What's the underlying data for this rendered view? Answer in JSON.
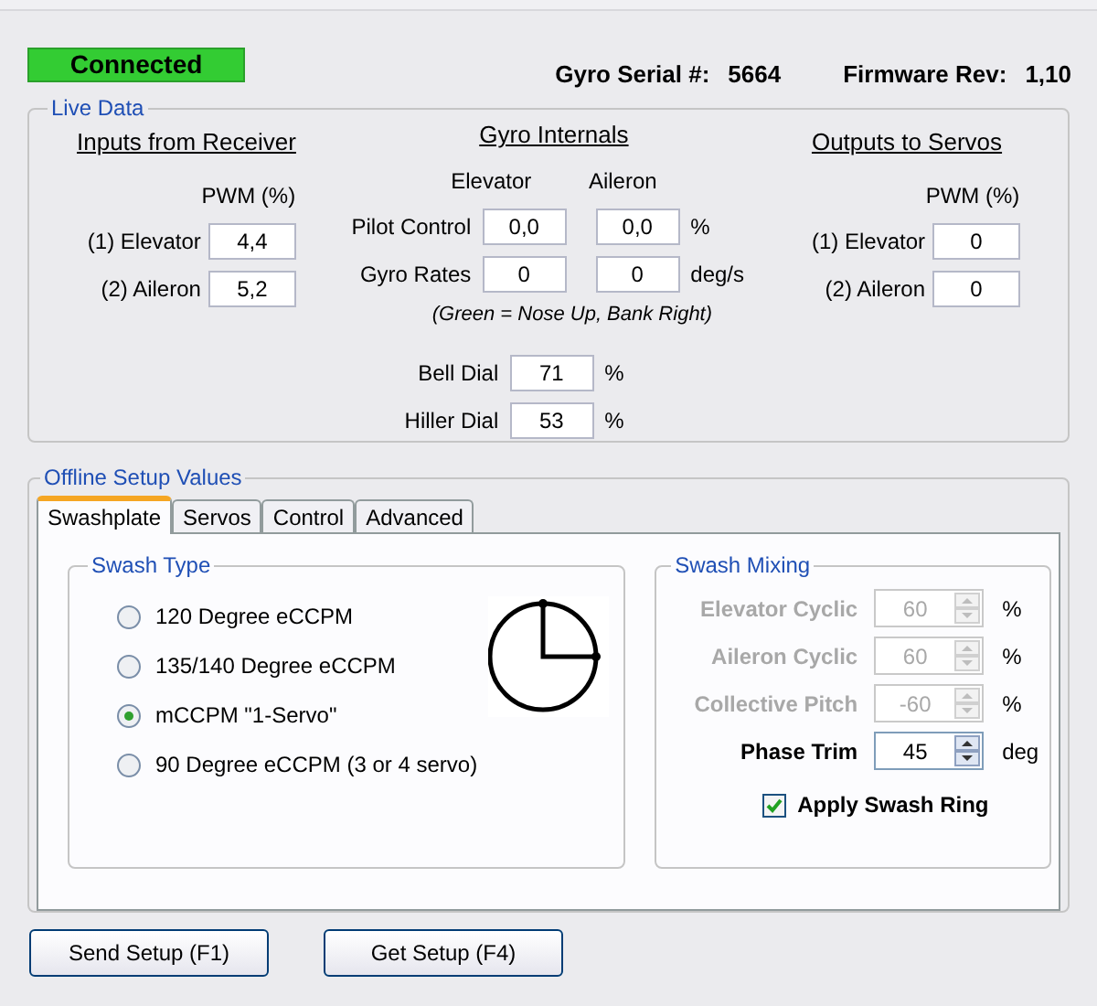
{
  "status": {
    "text": "Connected",
    "connected": true
  },
  "serial": {
    "label": "Gyro Serial #:",
    "value": "5664"
  },
  "firmware": {
    "label": "Firmware Rev:",
    "value": "1,10"
  },
  "live_data": {
    "title": "Live Data",
    "inputs": {
      "title": "Inputs from Receiver",
      "column": "PWM (%)",
      "rows": [
        {
          "label": "(1) Elevator",
          "value": "4,4"
        },
        {
          "label": "(2) Aileron",
          "value": "5,2"
        }
      ]
    },
    "internals": {
      "title": "Gyro Internals",
      "columns": [
        "Elevator",
        "Aileron"
      ],
      "rows": [
        {
          "label": "Pilot Control",
          "values": [
            "0,0",
            "0,0"
          ],
          "unit": "%"
        },
        {
          "label": "Gyro Rates",
          "values": [
            "0",
            "0"
          ],
          "unit": "deg/s"
        }
      ],
      "note": "(Green = Nose Up, Bank Right)",
      "dials": [
        {
          "label": "Bell Dial",
          "value": "71",
          "unit": "%"
        },
        {
          "label": "Hiller Dial",
          "value": "53",
          "unit": "%"
        }
      ]
    },
    "outputs": {
      "title": "Outputs to Servos",
      "column": "PWM (%)",
      "rows": [
        {
          "label": "(1) Elevator",
          "value": "0"
        },
        {
          "label": "(2) Aileron",
          "value": "0"
        }
      ]
    }
  },
  "offline": {
    "title": "Offline Setup Values",
    "tabs": [
      {
        "label": "Swashplate",
        "selected": true
      },
      {
        "label": "Servos",
        "selected": false
      },
      {
        "label": "Control",
        "selected": false
      },
      {
        "label": "Advanced",
        "selected": false
      }
    ],
    "swash_type": {
      "title": "Swash Type",
      "options": [
        {
          "label": "120 Degree eCCPM",
          "selected": false
        },
        {
          "label": "135/140 Degree eCCPM",
          "selected": false
        },
        {
          "label": "mCCPM \"1-Servo\"",
          "selected": true
        },
        {
          "label": "90 Degree eCCPM (3 or 4 servo)",
          "selected": false
        }
      ]
    },
    "swash_mixing": {
      "title": "Swash Mixing",
      "rows": [
        {
          "label": "Elevator Cyclic",
          "value": "60",
          "unit": "%",
          "disabled": true
        },
        {
          "label": "Aileron Cyclic",
          "value": "60",
          "unit": "%",
          "disabled": true
        },
        {
          "label": "Collective Pitch",
          "value": "-60",
          "unit": "%",
          "disabled": true
        },
        {
          "label": "Phase Trim",
          "value": "45",
          "unit": "deg",
          "disabled": false
        }
      ],
      "checkbox": {
        "label": "Apply Swash Ring",
        "checked": true
      }
    }
  },
  "buttons": [
    "Send Setup (F1)",
    "Get Setup (F4)"
  ]
}
